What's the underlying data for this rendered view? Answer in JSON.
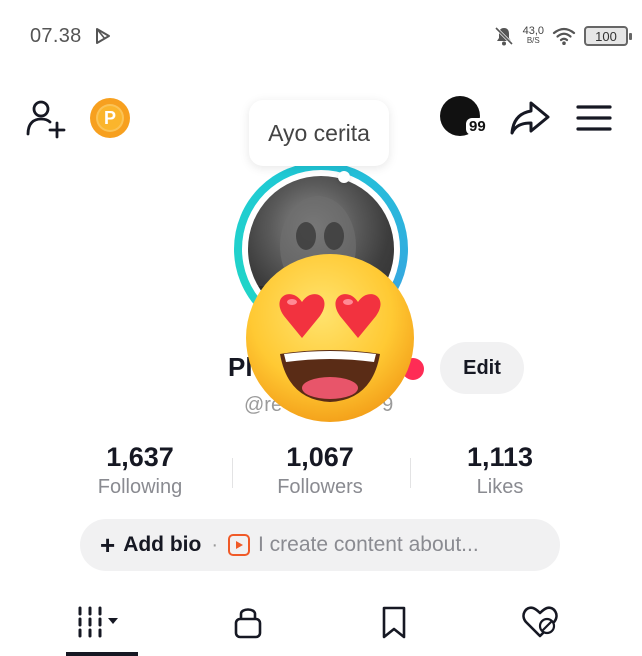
{
  "status_bar": {
    "time": "07.38",
    "speed_value": "43,0",
    "speed_unit": "B/S",
    "battery": "100",
    "icons": [
      "play-store-icon",
      "bell-muted-icon",
      "wifi-icon",
      "battery-icon"
    ]
  },
  "top_nav": {
    "icons": [
      "add-friend-icon",
      "coin-icon",
      "notification-avatar",
      "share-icon",
      "menu-icon"
    ],
    "coin_letter": "P",
    "notification_count": "99"
  },
  "profile": {
    "bubble_text": "Ayo cerita",
    "display_name": "Pl",
    "handle": "@re",
    "handle_tail": "9",
    "edit_label": "Edit"
  },
  "stats": [
    {
      "value": "1,637",
      "label": "Following"
    },
    {
      "value": "1,067",
      "label": "Followers"
    },
    {
      "value": "1,113",
      "label": "Likes"
    }
  ],
  "bio": {
    "add_label": "Add bio",
    "separator": "·",
    "prompt": "I create content about..."
  },
  "tabs": [
    "videos-grid-icon",
    "lock-icon",
    "bookmark-icon",
    "liked-heart-icon"
  ],
  "colors": {
    "accent_red": "#fe2c55",
    "ring_cyan": "#1fc6d8",
    "coin_orange": "#f7a01f",
    "text_primary": "#161823",
    "text_secondary": "#8a8b91"
  }
}
